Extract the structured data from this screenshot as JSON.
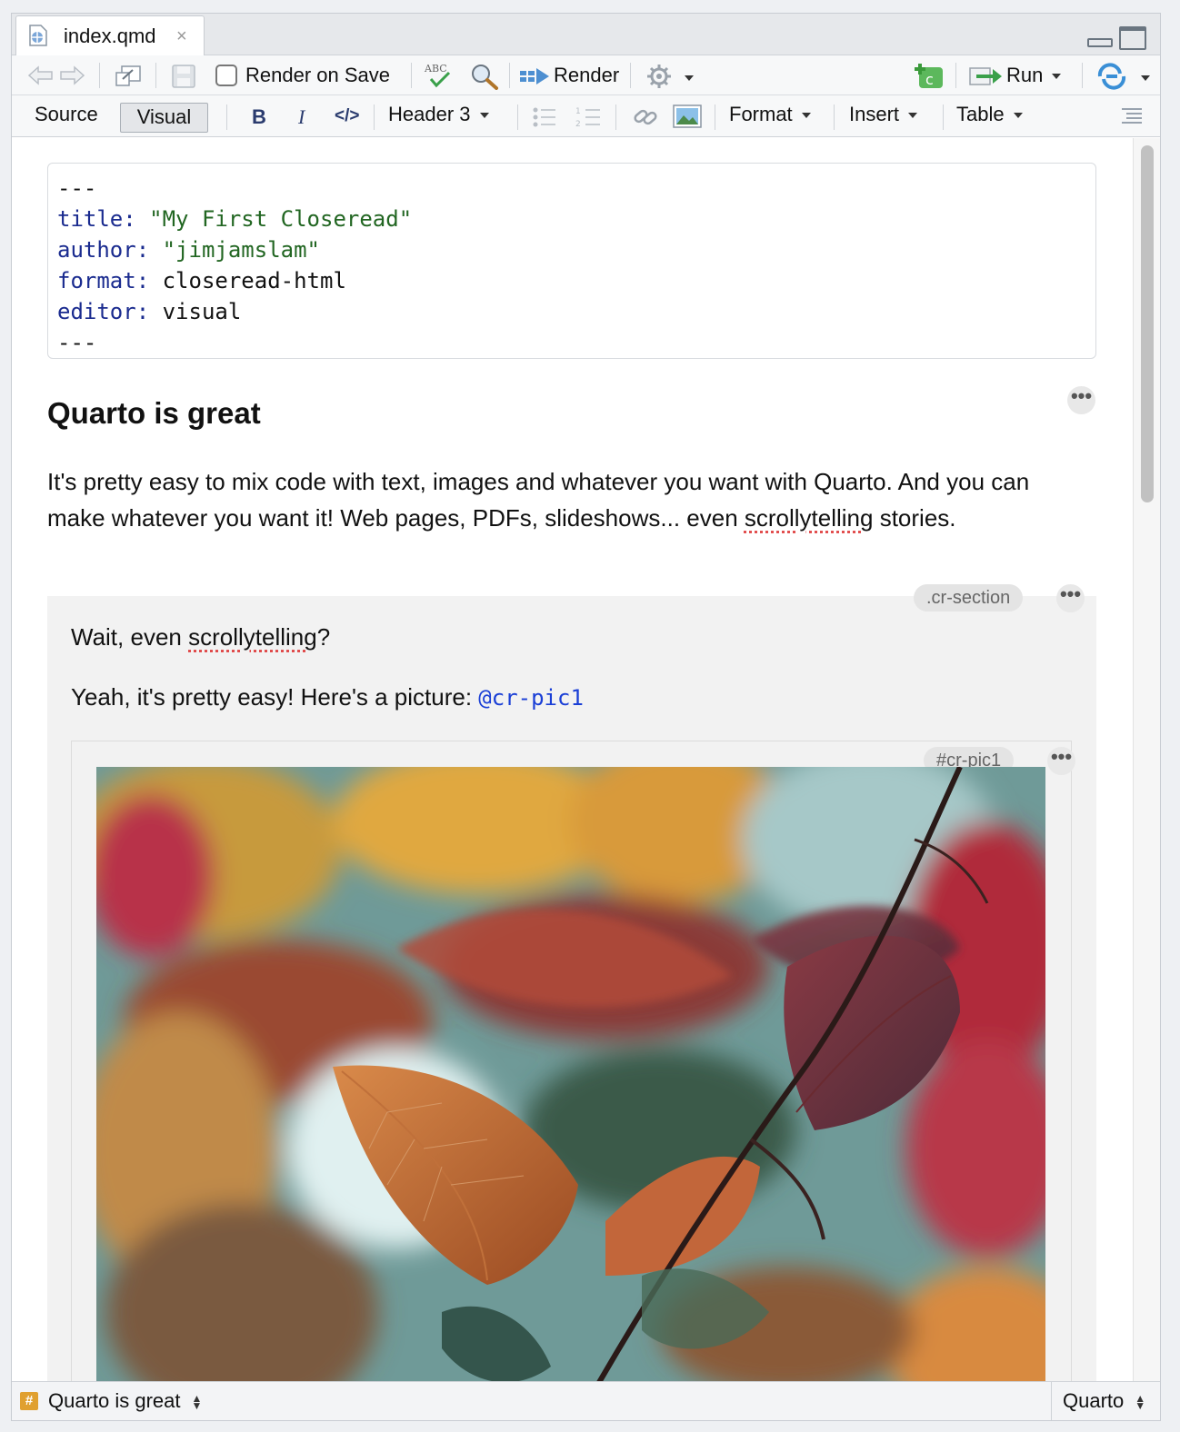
{
  "tab": {
    "filename": "index.qmd",
    "close": "×"
  },
  "toolbar1": {
    "render_on_save": "Render on Save",
    "spell": "ABC",
    "render": "Render",
    "run": "Run"
  },
  "toolbar2": {
    "source": "Source",
    "visual": "Visual",
    "bold": "B",
    "italic": "I",
    "code": "</>",
    "header": "Header 3",
    "format": "Format",
    "insert": "Insert",
    "table": "Table"
  },
  "yaml": {
    "dashes": "---",
    "lines": [
      {
        "key": "title",
        "value": "\"My First Closeread\"",
        "quoted": true
      },
      {
        "key": "author",
        "value": "\"jimjamslam\"",
        "quoted": true
      },
      {
        "key": "format",
        "value": "closeread-html",
        "quoted": false
      },
      {
        "key": "editor",
        "value": "visual",
        "quoted": false
      }
    ]
  },
  "content": {
    "heading": "Quarto is great",
    "para_part1": "It's pretty easy to mix code with text, images and whatever you want with Quarto. And you can make whatever you want it! Web pages, PDFs, slideshows... even ",
    "para_misspelled": "scrollytelling",
    "para_part2": " stories.",
    "section_class": ".cr-section",
    "wait_part1": "Wait, even ",
    "wait_misspelled": "scrollytelling",
    "wait_part2": "?",
    "yeah_text": "Yeah, it's pretty easy! Here's a picture: ",
    "xref": "@cr-pic1",
    "image_id": "#cr-pic1",
    "more": "•••"
  },
  "status": {
    "hash": "#",
    "section": "Quarto is great",
    "language": "Quarto"
  },
  "colors": {
    "yaml_key": "#1a2b8f",
    "yaml_string": "#226622",
    "xref": "#1a3fd6",
    "spell_underline": "#dd3333"
  }
}
